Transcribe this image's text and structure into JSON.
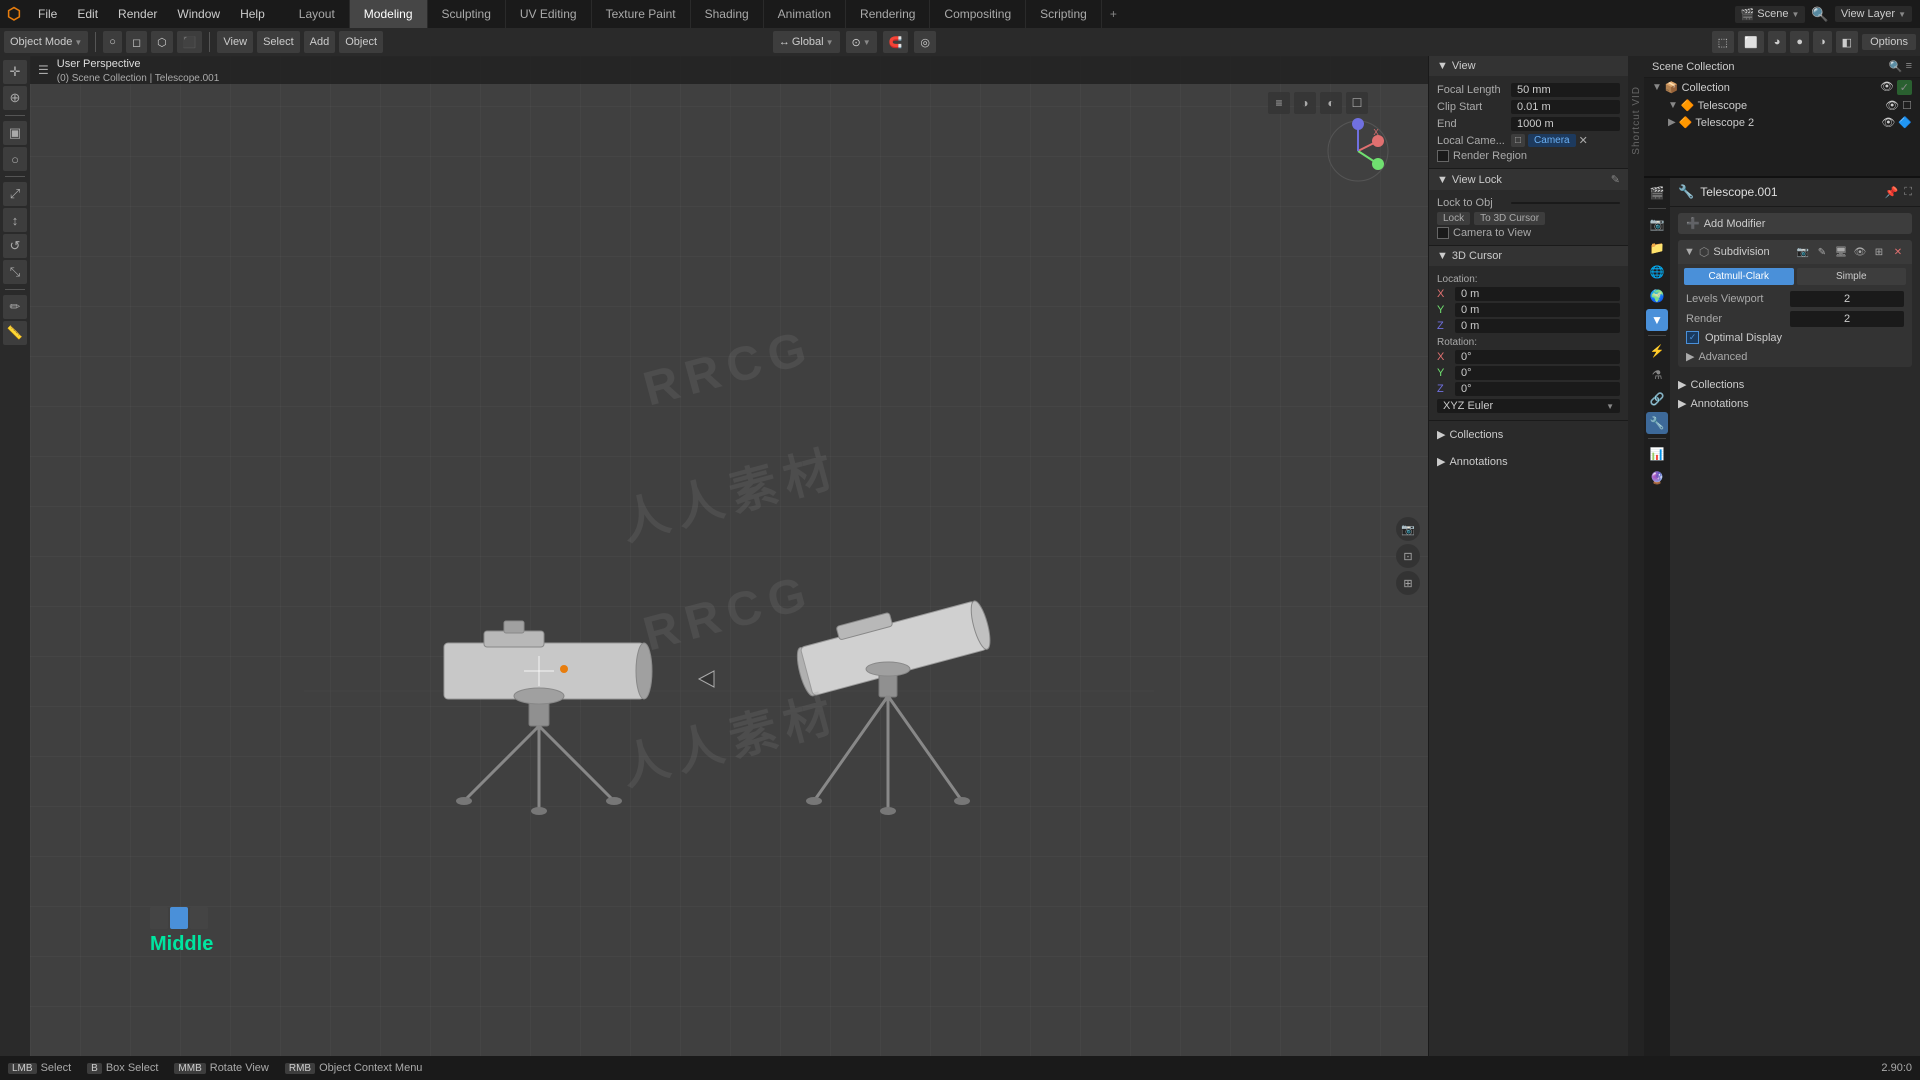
{
  "app": {
    "title": "Blender",
    "logo": "B"
  },
  "topmenu": {
    "items": [
      "File",
      "Edit",
      "Render",
      "Window",
      "Help"
    ],
    "workspaces": [
      "Layout",
      "Modeling",
      "Sculpting",
      "UV Editing",
      "Texture Paint",
      "Shading",
      "Animation",
      "Rendering",
      "Compositing",
      "Scripting",
      "+"
    ],
    "active_workspace": "Modeling",
    "scene": "Scene",
    "view_layer": "View Layer",
    "options_label": "Options"
  },
  "second_toolbar": {
    "object_mode": "Object Mode",
    "global": "Global",
    "transform_icon": "↔",
    "pivot_icon": "⊙"
  },
  "viewport": {
    "perspective": "User Perspective",
    "scene_path": "(0) Scene Collection | Telescope.001"
  },
  "npanel": {
    "view_section": "View",
    "focal_length_label": "Focal Length",
    "focal_length_value": "50 mm",
    "clip_start_label": "Clip Start",
    "clip_start_value": "0.01 m",
    "clip_end_label": "End",
    "clip_end_value": "1000 m",
    "local_camera_label": "Local Came...",
    "camera_label": "Camera",
    "render_region": "Render Region",
    "view_lock_section": "View Lock",
    "lock_to_obj": "Lock to Obj",
    "lock_label": "Lock",
    "to_3d_cursor": "To 3D Cursor",
    "camera_to_view": "Camera to View",
    "cursor_section": "3D Cursor",
    "location_label": "Location:",
    "x_label": "X",
    "y_label": "Y",
    "z_label": "Z",
    "x_value": "0 m",
    "y_value": "0 m",
    "z_value": "0 m",
    "rotation_label": "Rotation:",
    "rx_value": "0°",
    "ry_value": "0°",
    "rz_value": "0°",
    "rotation_mode": "XYZ Euler",
    "collections_label": "Collections",
    "annotations_label": "Annotations"
  },
  "scene_outline": {
    "title": "Scene Collection",
    "items": [
      {
        "name": "Collection",
        "indent": 0,
        "collapsed": false,
        "icon": "📦"
      },
      {
        "name": "Telescope",
        "indent": 1,
        "icon": "🔭"
      },
      {
        "name": "Telescope 2",
        "indent": 1,
        "icon": "🔭"
      }
    ]
  },
  "properties": {
    "active_object": "Telescope.001",
    "add_modifier": "Add Modifier",
    "modifier_name": "Subdivision",
    "catmull_clark": "Catmull-Clark",
    "simple": "Simple",
    "levels_viewport_label": "Levels Viewport",
    "levels_viewport_value": "2",
    "render_label": "Render",
    "render_value": "2",
    "optimal_display": "Optimal Display",
    "advanced_label": "Advanced",
    "collections_header": "Collections",
    "annotations_header": "Annotations"
  },
  "middle_indicator": {
    "boxes": [
      false,
      true,
      false
    ],
    "label": "Middle"
  },
  "status_bar": {
    "select": "Select",
    "box_select": "Box Select",
    "rotate_view": "Rotate View",
    "object_context": "Object Context Menu",
    "zoom": "2.90:0"
  }
}
